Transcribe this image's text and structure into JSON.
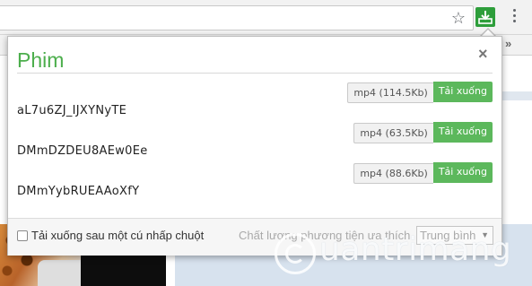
{
  "browser": {
    "star_icon": "star-icon",
    "extension_icon": "download-icon",
    "menu_icon": "more-vertical-icon",
    "bookmarks_overflow": "»"
  },
  "popup": {
    "title": "Phim",
    "close": "×",
    "items": [
      {
        "format": "mp4 (114.5Kb)",
        "download_label": "Tải xuống",
        "name": "aL7u6ZJ_IJXYNyTE"
      },
      {
        "format": "mp4 (63.5Kb)",
        "download_label": "Tải xuống",
        "name": "DMmDZDEU8AEw0Ee"
      },
      {
        "format": "mp4 (88.6Kb)",
        "download_label": "Tải xuống",
        "name": "DMmYybRUEAAoXfY"
      }
    ],
    "footer": {
      "checkbox_label": "Tải xuống sau một cú nhấp chuột",
      "checkbox_checked": false,
      "quality_label": "Chất lượng phương tiện ưa thích",
      "quality_value": "Trung bình"
    }
  },
  "watermark": {
    "text": "uantrimang"
  },
  "colors": {
    "accent_green": "#5cb85c",
    "title_green": "#4cae4c",
    "extension_green": "#2e9e3b"
  }
}
